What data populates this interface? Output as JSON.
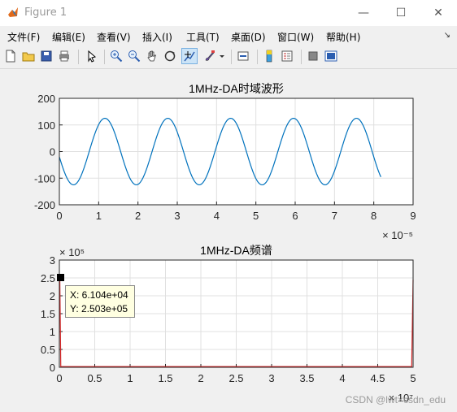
{
  "window": {
    "title": "Figure 1"
  },
  "menu": [
    "文件(F)",
    "编辑(E)",
    "查看(V)",
    "插入(I)",
    "工具(T)",
    "桌面(D)",
    "窗口(W)",
    "帮助(H)"
  ],
  "toolbar": {
    "icons": [
      "new-figure-icon",
      "open-file-icon",
      "save-icon",
      "print-icon",
      "select-arrow-icon",
      "zoom-in-icon",
      "zoom-out-icon",
      "pan-hand-icon",
      "rotate-3d-icon",
      "data-cursor-icon",
      "brush-icon",
      "link-icon",
      "colorbar-icon",
      "legend-icon",
      "hide-plot-tools-icon",
      "show-plot-tools-icon"
    ]
  },
  "chart_data": [
    {
      "type": "line",
      "title": "1MHz-DA时域波形",
      "xlim": [
        0,
        9
      ],
      "x_exponent_label": "× 10⁻⁵",
      "ylim": [
        -200,
        200
      ],
      "xticks": [
        "0",
        "1",
        "2",
        "3",
        "4",
        "5",
        "6",
        "7",
        "8",
        "9"
      ],
      "yticks": [
        "200",
        "100",
        "0",
        "-100",
        "-200"
      ],
      "grid": true,
      "series": [
        {
          "color": "#0072bd",
          "waveform": "sine",
          "amplitude": 125,
          "period": 1.6,
          "x_start": 0,
          "x_end": 8.18,
          "y_start": -20
        }
      ]
    },
    {
      "type": "line",
      "title": "1MHz-DA频谱",
      "xlim": [
        0,
        5
      ],
      "x_exponent_label": "× 10⁷",
      "y_exponent_label": "× 10⁵",
      "ylim": [
        0,
        3
      ],
      "xticks": [
        "0",
        "0.5",
        "1",
        "1.5",
        "2",
        "2.5",
        "3",
        "3.5",
        "4",
        "4.5",
        "5"
      ],
      "yticks": [
        "3",
        "2.5",
        "2",
        "1.5",
        "1",
        "0.5",
        "0"
      ],
      "grid": true,
      "series": [
        {
          "color": "#d62728",
          "description_points": [
            [
              0,
              2.503
            ],
            [
              0.0061,
              2.503
            ],
            [
              0.02,
              0.02
            ],
            [
              4.98,
              0.02
            ],
            [
              5,
              2.45
            ]
          ]
        }
      ],
      "datatip": {
        "x_label": "X: 6.104e+04",
        "y_label": "Y: 2.503e+05"
      }
    }
  ],
  "watermark": "CSDN @lwt×csdn_edu"
}
